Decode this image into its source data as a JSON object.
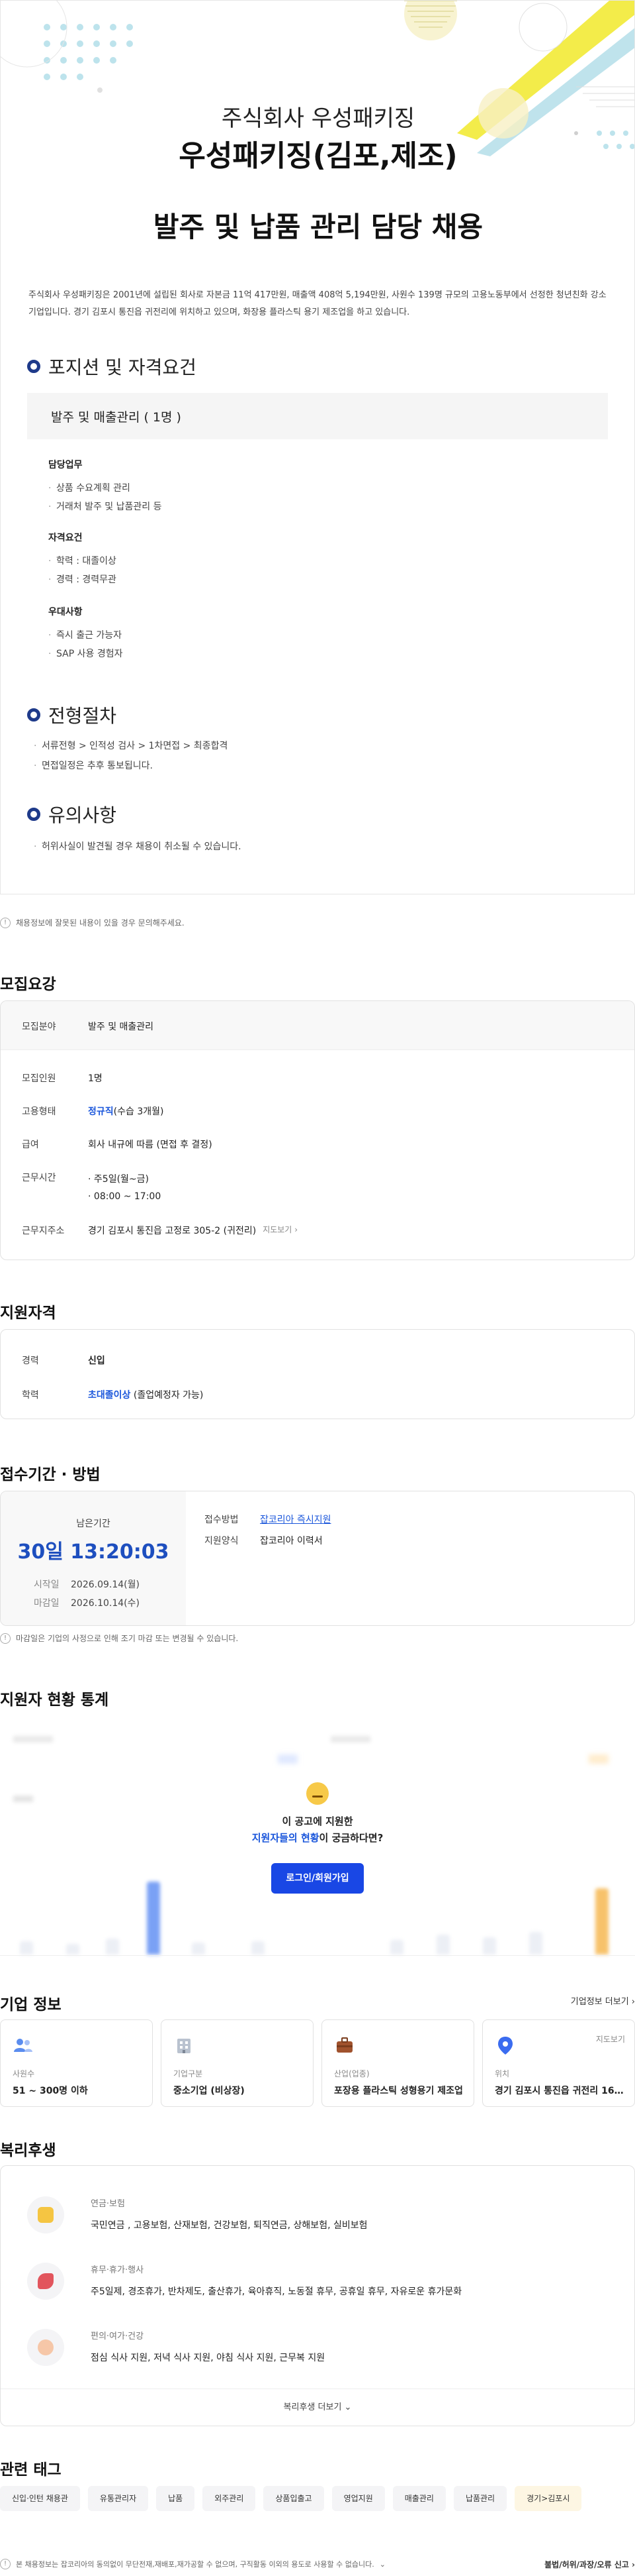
{
  "posting": {
    "company_line": "주식회사 우성패키징",
    "company_title": "우성패키징(김포,제조)",
    "job_title": "발주 및 납품 관리 담당 채용",
    "intro": "주식회사 우성패키징은 2001년에 설립된 회사로 자본금 11억 417만원, 매출액 408억 5,194만원, 사원수 139명 규모의 고용노동부에서 선정한 청년친화 강소기업입니다. 경기 김포시 통진읍 귀전리에 위치하고 있으며, 화장용 플라스틱 용기 제조업을 하고 있습니다.",
    "position_heading": "포지션 및 자격요건",
    "position_box": "발주 및 매출관리 ( 1명 )",
    "duty_title": "담당업무",
    "duties": [
      "상품 수요계획 관리",
      "거래처 발주 및 납품관리 등"
    ],
    "qual_title": "자격요건",
    "quals": [
      "학력 : 대졸이상",
      "경력 : 경력무관"
    ],
    "pref_title": "우대사항",
    "prefs": [
      "즉시 출근 가능자",
      "SAP 사용 경험자"
    ],
    "process_heading": "전형절차",
    "process": [
      "서류전형 > 인적성 검사 > 1차면접 > 최종합격",
      "면접일정은 추후 통보됩니다."
    ],
    "caution_heading": "유의사항",
    "cautions": [
      "허위사실이 발견될 경우 채용이 취소될 수 있습니다."
    ]
  },
  "notice1": "채용정보에 잘못된 내용이 있을 경우 문의해주세요.",
  "recruit": {
    "heading": "모집요강",
    "field_k": "모집분야",
    "field_v": "발주 및 매출관리",
    "count_k": "모집인원",
    "count_v": "1명",
    "type_k": "고용형태",
    "type_v1": "정규직",
    "type_v2": "(수습 3개월)",
    "pay_k": "급여",
    "pay_v": "회사 내규에 따름 (면접 후 결정)",
    "time_k": "근무시간",
    "time_v1": "주5일(월~금)",
    "time_v2": "08:00 ~ 17:00",
    "addr_k": "근무지주소",
    "addr_v": "경기 김포시 통진읍 고정로 305-2 (귀전리)",
    "addr_link": "지도보기"
  },
  "qualify": {
    "heading": "지원자격",
    "exp_k": "경력",
    "exp_v": "신입",
    "edu_k": "학력",
    "edu_v1": "초대졸이상",
    "edu_v2": "(졸업예정자 가능)"
  },
  "period": {
    "heading": "접수기간 · 방법",
    "remain_label": "남은기간",
    "remain_val": "30일 13:20:03",
    "start_k": "시작일",
    "start_v": "2026.09.14(월)",
    "end_k": "마감일",
    "end_v": "2026.10.14(수)",
    "method_k": "접수방법",
    "method_v": "잡코리아 즉시지원",
    "form_k": "지원양식",
    "form_v": "잡코리아 이력서"
  },
  "notice2": "마감일은 기업의 사정으로 인해 조기 마감 또는 변경될 수 있습니다.",
  "stats": {
    "heading": "지원자 현황 통계",
    "line1": "이 공고에 지원한",
    "line2a": "지원자들의 현황",
    "line2b": "이 궁금하다면?",
    "login": "로그인/회원가입"
  },
  "company": {
    "heading": "기업 정보",
    "more": "기업정보 더보기",
    "cards": [
      {
        "label": "사원수",
        "value": "51 ~ 300명 이하"
      },
      {
        "label": "기업구분",
        "value": "중소기업 (비상장)"
      },
      {
        "label": "산업(업종)",
        "value": "포장용 플라스틱 성형용기 제조업"
      },
      {
        "label": "위치",
        "value": "경기 김포시 통진읍 귀전리 168...",
        "link": "지도보기"
      }
    ]
  },
  "welfare": {
    "heading": "복리후생",
    "items": [
      {
        "title": "연금·보험",
        "desc": "국민연금 , 고용보험, 산재보험, 건강보험, 퇴직연금, 상해보험, 실비보험"
      },
      {
        "title": "휴무·휴가·행사",
        "desc": "주5일제, 경조휴가, 반차제도, 출산휴가, 육아휴직, 노동절 휴무, 공휴일 휴무, 자유로운 휴가문화"
      },
      {
        "title": "편의·여가·건강",
        "desc": "점심 식사 지원, 저녁 식사 지원, 야침 식사 지원, 근무복 지원"
      }
    ],
    "more": "복리후생 더보기"
  },
  "tags": {
    "heading": "관련 태그",
    "items": [
      "신입·인턴 채용관",
      "유통관리자",
      "납품",
      "외주관리",
      "상품입출고",
      "영업지원",
      "매출관리",
      "납품관리",
      "경기>김포시"
    ]
  },
  "footer": {
    "left": "본 채용정보는 잡코리아의 동의없이 무단전재,재배포,재가공할 수 없으며, 구직활동 이외의 용도로 사용할 수 없습니다.",
    "right": "불법/허위/과장/오류 신고"
  }
}
